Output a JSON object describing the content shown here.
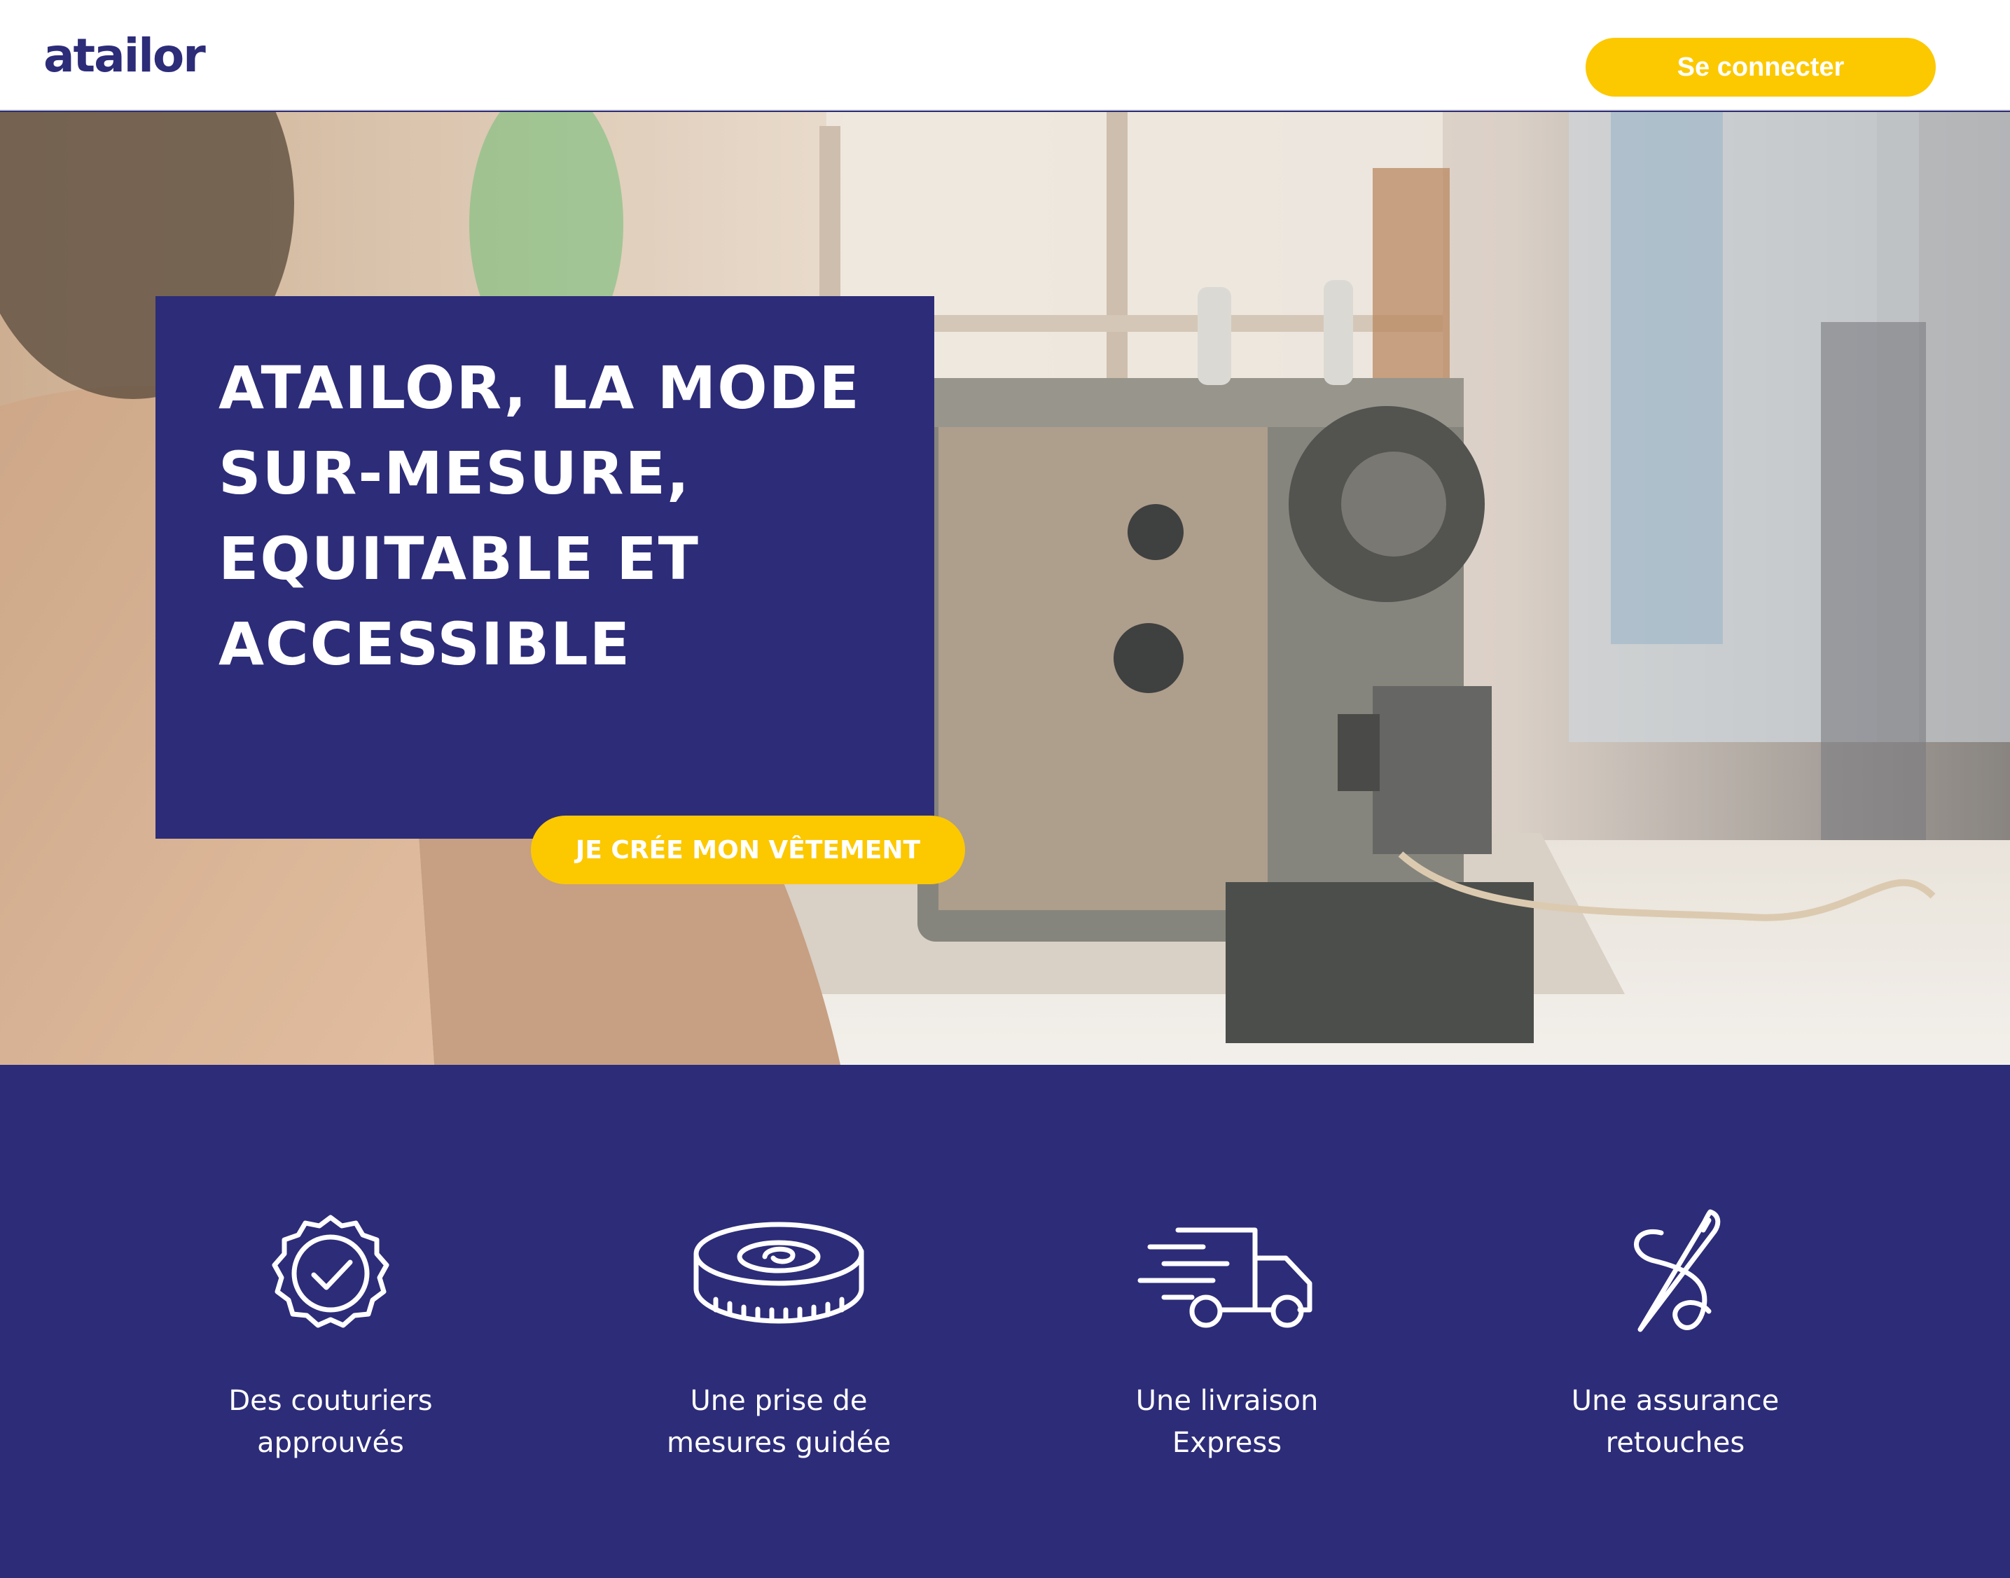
{
  "header": {
    "logo_text": "atailor",
    "login_label": "Se connecter"
  },
  "hero": {
    "title": "ATAILOR, LA MODE SUR-MESURE, EQUITABLE ET ACCESSIBLE",
    "cta_label": "JE CRÉE MON VÊTEMENT",
    "image_description": "sewing-machine-photo"
  },
  "features": [
    {
      "icon": "approved-badge-icon",
      "label": "Des couturiers approuvés"
    },
    {
      "icon": "measuring-tape-icon",
      "label": "Une prise de mesures guidée"
    },
    {
      "icon": "delivery-truck-icon",
      "label": "Une livraison Express"
    },
    {
      "icon": "needle-thread-icon",
      "label": "Une assurance retouches"
    }
  ],
  "colors": {
    "brand_navy": "#2d2c79",
    "accent_yellow": "#fcc800",
    "white": "#ffffff"
  }
}
